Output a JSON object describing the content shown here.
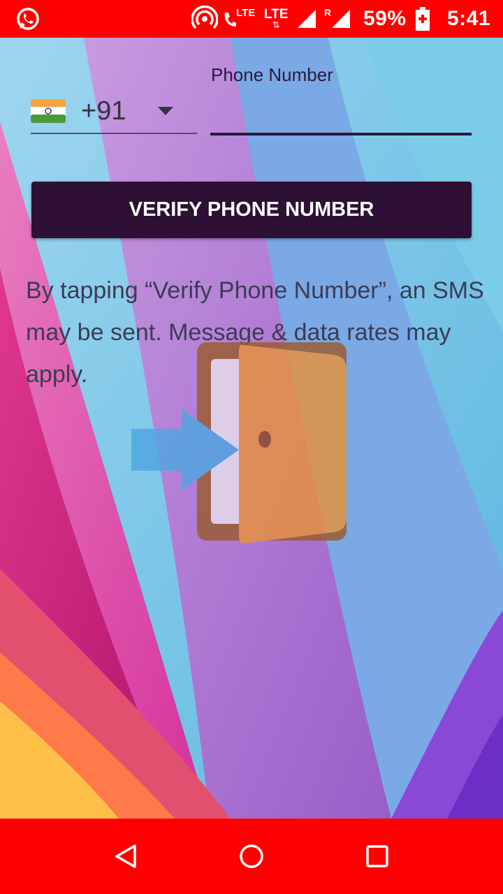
{
  "status_bar": {
    "app_icon": "whatsapp-icon",
    "hotspot_icon": "hotspot-icon",
    "call_lte_label": "LTE",
    "data_lte_label": "LTE",
    "signal_1_icon": "signal-icon",
    "signal_2_roaming": "R",
    "battery_percent": "59%",
    "battery_icon": "battery-charging-icon",
    "time": "5:41"
  },
  "form": {
    "country_flag": "india-flag-icon",
    "country_code": "+91",
    "phone_label": "Phone Number",
    "phone_value": "",
    "verify_button": "VERIFY PHONE NUMBER",
    "disclaimer": "By tapping “Verify Phone Number”, an SMS may be sent. Message & data rates may apply."
  },
  "overlay_icon": "sign-in-door-icon",
  "nav_bar": {
    "back": "back-triangle-icon",
    "home": "home-circle-icon",
    "recents": "recents-square-icon"
  },
  "colors": {
    "status_bar": "#ff0000",
    "nav_bar": "#ff0000",
    "button": "#2e1034",
    "text": "#3b3c55"
  }
}
